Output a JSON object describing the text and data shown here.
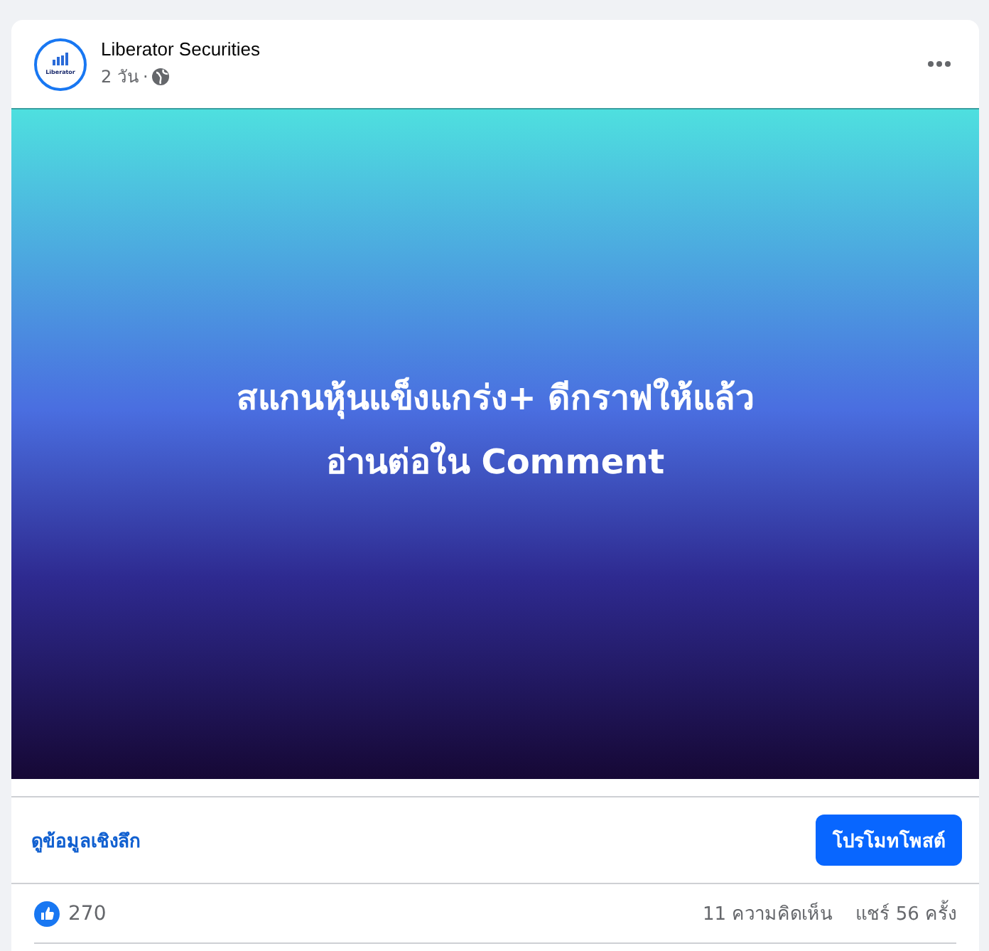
{
  "post": {
    "author": "Liberator Securities",
    "logo_text": "Liberator",
    "time": "2 วัน",
    "separator": "·",
    "image": {
      "lines": [
        "สแกนหุ้นแข็งแกร่ง+ ดีกราฟให้แล้ว",
        "อ่านต่อใน Comment"
      ]
    },
    "insights_link": "ดูข้อมูลเชิงลึก",
    "promote_button": "โปรโมทโพสต์",
    "reactions": "270",
    "comments": "11 ความคิดเห็น",
    "shares": "แชร์ 56 ครั้ง"
  }
}
